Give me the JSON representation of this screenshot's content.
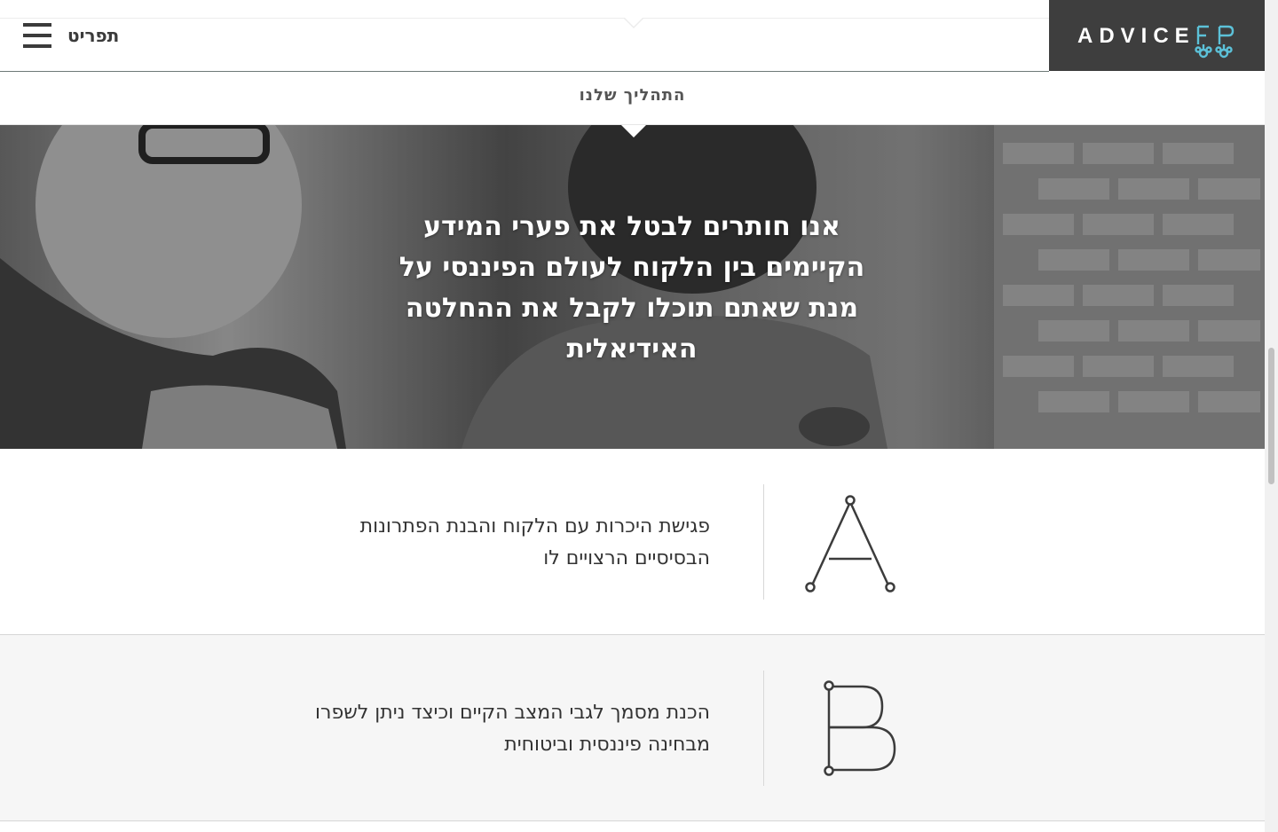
{
  "header": {
    "menu_label": "תפריט",
    "logo_text": "ADVICE",
    "logo_mark": "FP"
  },
  "section": {
    "title": "התהליך שלנו"
  },
  "hero": {
    "quote": "אנו חותרים לבטל את פערי המידע הקיימים בין הלקוח לעולם הפיננסי על מנת שאתם תוכלו לקבל את ההחלטה האידיאלית"
  },
  "steps": [
    {
      "letter": "A",
      "text": "פגישת היכרות עם הלקוח והבנת הפתרונות הבסיסיים הרצויים לו"
    },
    {
      "letter": "B",
      "text": "הכנת מסמך לגבי המצב הקיים וכיצד ניתן לשפרו מבחינה פיננסית וביטוחית"
    }
  ],
  "colors": {
    "logo_bg": "#3e3e3e",
    "logo_accent": "#5cc1d8",
    "text": "#333333",
    "step_b_bg": "#f6f6f6"
  }
}
